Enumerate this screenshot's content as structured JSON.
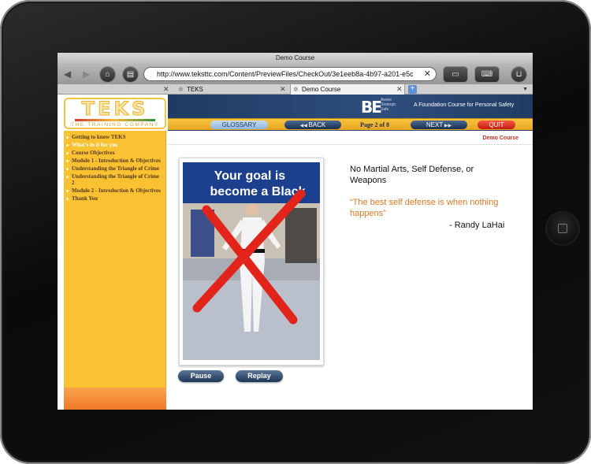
{
  "browser": {
    "window_title": "Demo Course",
    "url": "http://www.teksttc.com/Content/PreviewFiles/CheckOut/3e1eeb8a-4b97-a201-e5c",
    "tabs": [
      {
        "label": "TEKS"
      },
      {
        "label": "Demo Course"
      }
    ]
  },
  "course": {
    "logo": {
      "word": "TEKS",
      "subtitle": "THE TRAINING COMPANY"
    },
    "brand_mark": "BE",
    "brand_words": [
      "Aware",
      "Strategic",
      "Safe"
    ],
    "tagline": "A Foundation Course for Personal Safety",
    "nav": {
      "glossary": "GLOSSARY",
      "back": "BACK",
      "page_indicator": "Page 2 of 8",
      "next": "NEXT",
      "quit": "QUIT"
    },
    "course_label": "Demo Course",
    "menu": [
      {
        "label": "Getting to know TEKS",
        "active": false
      },
      {
        "label": "What's in it for you",
        "active": true
      },
      {
        "label": "Course Objectives",
        "active": false
      },
      {
        "label": "Module 1 - Introduction & Objectives",
        "active": false
      },
      {
        "label": "Understanding the Triangle of Crime",
        "active": false
      },
      {
        "label": "Understanding the Triangle of Crime 2",
        "active": false
      },
      {
        "label": "Module 2 - Introduction & Objectives",
        "active": false
      },
      {
        "label": "Thank You",
        "active": false
      }
    ],
    "photo_banner": "Your goal is\nbecome a Black",
    "media_controls": {
      "pause": "Pause",
      "replay": "Replay"
    },
    "quote": {
      "heading": "No Martial Arts, Self Defense, or Weapons",
      "text": "“The best self defense is when nothing happens”",
      "author": "- Randy LaHai"
    }
  },
  "colors": {
    "accent_yellow": "#fac233",
    "navy": "#1f3a64",
    "quote_orange": "#e5771f",
    "quit_red": "#c51d10"
  }
}
